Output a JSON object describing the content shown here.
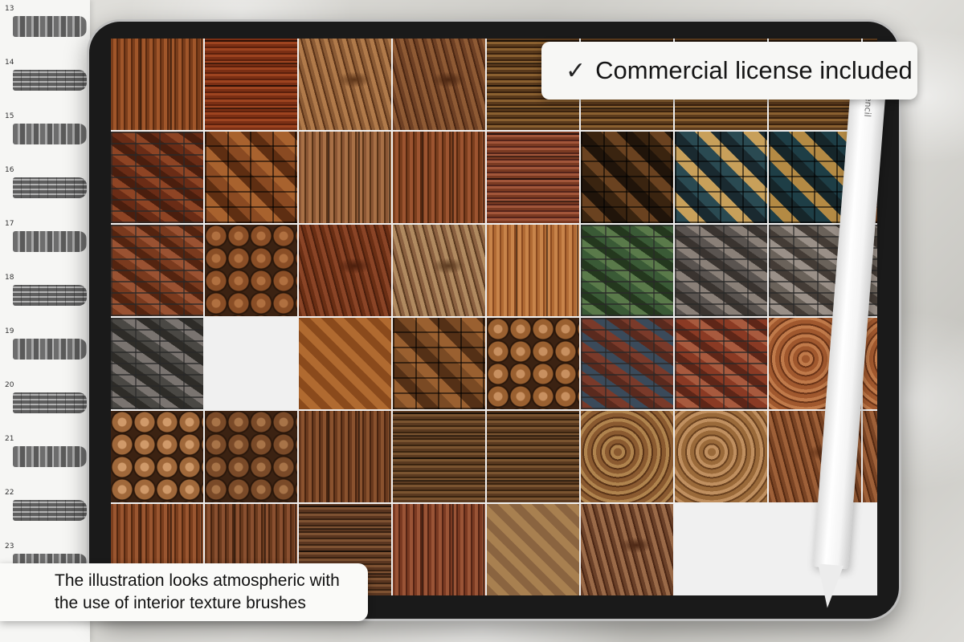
{
  "badge": {
    "check": "✓",
    "text": "Commercial license included"
  },
  "caption": {
    "line1": "The illustration looks atmospheric with",
    "line2": "the use of interior texture brushes"
  },
  "pencil": {
    "label": "Pencil"
  },
  "brush_numbers": [
    "13",
    "14",
    "15",
    "16",
    "17",
    "18",
    "19",
    "20",
    "21",
    "22",
    "23"
  ],
  "tiles": [
    [
      "wood-v",
      "#7a3d1b",
      "#a0562a",
      "#5a2a10"
    ],
    [
      "wood-h",
      "#7b2f14",
      "#9e4420",
      "#5c200c"
    ],
    [
      "wood-grain",
      "#8a5a34",
      "#b07a4a",
      "#5a3318"
    ],
    [
      "wood-grain",
      "#6e4024",
      "#8e5a34",
      "#4a2612"
    ],
    [
      "wood-h",
      "#5a3a1c",
      "#8a6030",
      "#3a220e"
    ],
    [
      "wood-h",
      "#5a3a1c",
      "#8a6030",
      "#3a220e"
    ],
    [
      "wood-h",
      "#5a3a1c",
      "#8a6030",
      "#3a220e"
    ],
    [
      "wood-h",
      "#5a3a1c",
      "#8a6030",
      "#3a220e"
    ],
    [
      "wood-h",
      "#5a3a1c",
      "#8a6030",
      "#3a220e"
    ],
    [
      "bricks",
      "#6a2c16",
      "#8e4424",
      "#4a1e0e"
    ],
    [
      "blocks",
      "#8a4a22",
      "#a8622e",
      "#5e2e12"
    ],
    [
      "wood-v",
      "#8a5634",
      "#a87046",
      "#5a3418"
    ],
    [
      "wood-v",
      "#7a3e1e",
      "#9c5430",
      "#562810"
    ],
    [
      "wood-h",
      "#7a3a22",
      "#a2563a",
      "#54241a"
    ],
    [
      "blocks",
      "#3a2410",
      "#6a4220",
      "#20140a"
    ],
    [
      "blocks",
      "#2a4a52",
      "#c8a05a",
      "#1a2a30"
    ],
    [
      "blocks",
      "#1e3e46",
      "#b48a44",
      "#16262a"
    ],
    [
      "blocks",
      "#4a2a14",
      "#6a3c1c",
      "#2a160a"
    ],
    [
      "bricks",
      "#7a3a1e",
      "#9a5232",
      "#542410"
    ],
    [
      "logs",
      "#8a4e26",
      "#b07040",
      "#3b2212"
    ],
    [
      "wood-grain",
      "#6a2e14",
      "#8a4426",
      "#4a1e0c"
    ],
    [
      "wood-grain",
      "#8a6040",
      "#b08a60",
      "#5a3a20"
    ],
    [
      "wood-v",
      "#b06a34",
      "#c8844a",
      "#8a4a20"
    ],
    [
      "bricks",
      "#3a5a36",
      "#5a7a4a",
      "#24381e"
    ],
    [
      "bricks",
      "#5a5450",
      "#8a8078",
      "#3a3430"
    ],
    [
      "bricks",
      "#6a625a",
      "#9a9088",
      "#443c36"
    ],
    [
      "bricks",
      "#6a625a",
      "#9a9088",
      "#443c36"
    ],
    [
      "bricks",
      "#4a4844",
      "#7a7470",
      "#2e2c28"
    ],
    [
      "tiles",
      "#a88848",
      "#e0c890",
      "#6a5020"
    ],
    [
      "chev",
      "#8a4a1c",
      "#b06a30"
    ],
    [
      "blocks",
      "#7a4a24",
      "#9a6030",
      "#543016"
    ],
    [
      "logs",
      "#9a6030",
      "#c89060",
      "#3b2212"
    ],
    [
      "bricks",
      "#7a3a2a",
      "#3a4a5a",
      "#5a2a1e"
    ],
    [
      "bricks",
      "#8a3a24",
      "#a85a3e",
      "#5e2618"
    ],
    [
      "rings",
      "#a0582e",
      "#c07a4a",
      "#6a3418"
    ],
    [
      "rings",
      "#a0582e",
      "#c07a4a",
      "#6a3418"
    ],
    [
      "logs",
      "#a0683a",
      "#d09a6a",
      "#3b2212"
    ],
    [
      "logs",
      "#7a4a28",
      "#a87448",
      "#2b180c"
    ],
    [
      "wood-v",
      "#6a3a1e",
      "#8a522e",
      "#482410"
    ],
    [
      "wood-h",
      "#5a3a20",
      "#7a5430",
      "#3a2410"
    ],
    [
      "wood-h",
      "#5a3a20",
      "#7a5430",
      "#3a2410"
    ],
    [
      "rings",
      "#8a5a30",
      "#b0844e",
      "#5a3418"
    ],
    [
      "rings",
      "#9a6a3a",
      "#c09060",
      "#6a4220"
    ],
    [
      "wood-grain",
      "#7a4424",
      "#9e6038",
      "#552a12"
    ],
    [
      "wood-grain",
      "#7a4424",
      "#9e6038",
      "#552a12"
    ],
    [
      "wood-v",
      "#7a3e1e",
      "#9a5630",
      "#542810"
    ],
    [
      "wood-v",
      "#6a3a1e",
      "#8a5030",
      "#482410"
    ],
    [
      "wood-h",
      "#5a3620",
      "#7e5232",
      "#3a2212"
    ],
    [
      "wood-v",
      "#7a3a22",
      "#9a5436",
      "#542414"
    ],
    [
      "chev",
      "#8a6440",
      "#a88050"
    ],
    [
      "wood-grain",
      "#6a4028",
      "#9a6a48",
      "#4a2614"
    ],
    [
      "tiles",
      "#2e4a3e",
      "#b8894a",
      "#3a2a1a"
    ],
    [
      "tiles",
      "#5a5a5a",
      "#8a8a82",
      "#3a3a3a"
    ],
    [
      "tiles",
      "#5a5a5a",
      "#8a8a82",
      "#3a3a3a"
    ]
  ]
}
